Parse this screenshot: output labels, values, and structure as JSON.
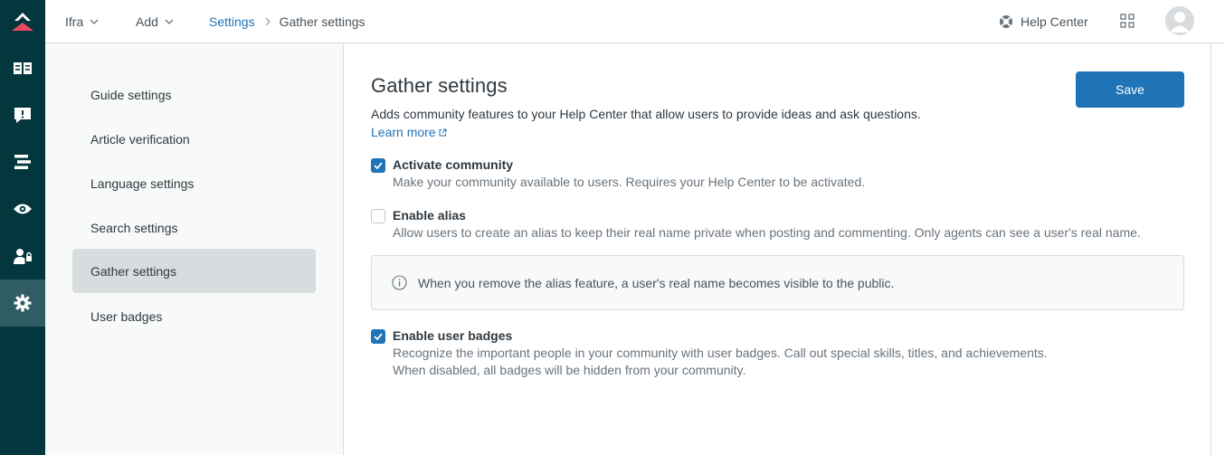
{
  "topbar": {
    "brand_menu": "Ifra",
    "add_menu": "Add",
    "breadcrumb": {
      "parent": "Settings",
      "current": "Gather settings"
    },
    "help_center": "Help Center"
  },
  "rail": {
    "items": [
      "knowledge-book-icon",
      "alert-bubble-icon",
      "layers-icon",
      "eye-icon",
      "user-lock-icon",
      "gear-icon"
    ],
    "active": "gear-icon"
  },
  "settings_nav": {
    "items": [
      {
        "label": "Guide settings"
      },
      {
        "label": "Article verification"
      },
      {
        "label": "Language settings"
      },
      {
        "label": "Search settings"
      },
      {
        "label": "Gather settings"
      },
      {
        "label": "User badges"
      }
    ],
    "active": "Gather settings"
  },
  "main": {
    "title": "Gather settings",
    "description": "Adds community features to your Help Center that allow users to provide ideas and ask questions.",
    "learn_more": "Learn more",
    "save_label": "Save",
    "options": [
      {
        "label": "Activate community",
        "checked": true,
        "hints": [
          "Make your community available to users. Requires your Help Center to be activated."
        ]
      },
      {
        "label": "Enable alias",
        "checked": false,
        "hints": [
          "Allow users to create an alias to keep their real name private when posting and commenting. Only agents can see a user's real name."
        ]
      },
      {
        "label": "Enable user badges",
        "checked": true,
        "hints": [
          "Recognize the important people in your community with user badges. Call out special skills, titles, and achievements.",
          "When disabled, all badges will be hidden from your community."
        ]
      }
    ],
    "notice": "When you remove the alias feature, a user's real name becomes visible to the public."
  },
  "colors": {
    "rail_bg": "#03363d",
    "accent": "#1f73b7",
    "brand_logo": "#eb4962"
  }
}
